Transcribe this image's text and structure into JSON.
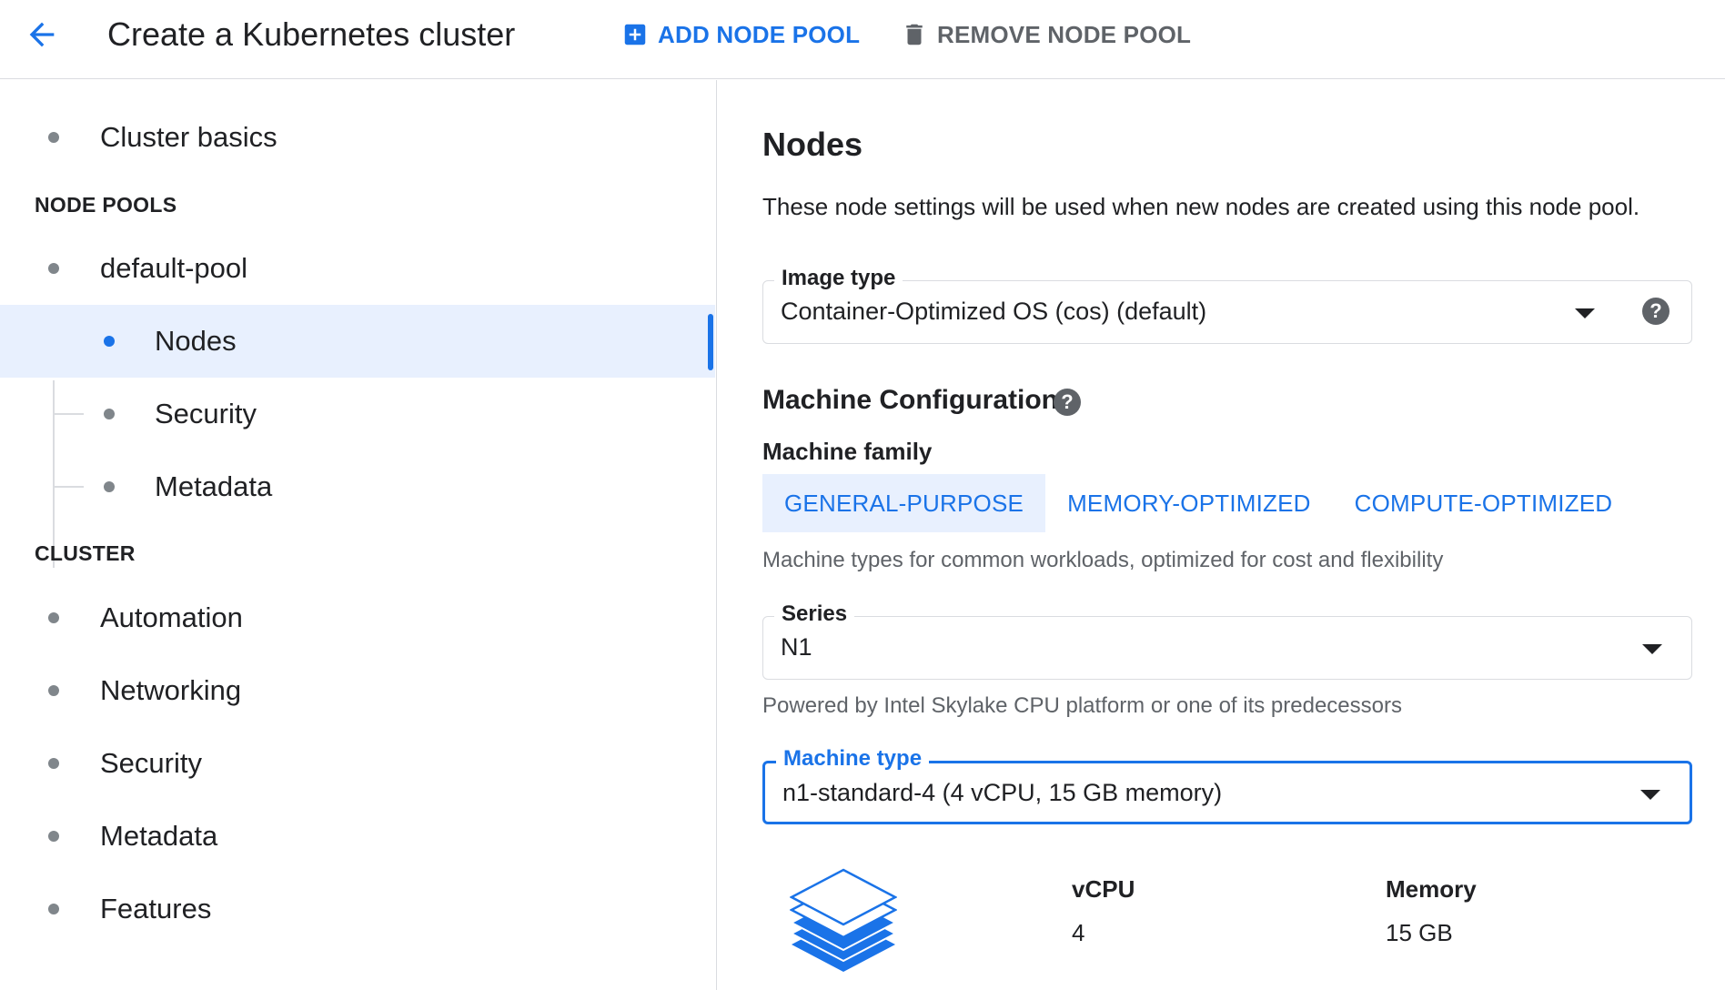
{
  "header": {
    "title": "Create a Kubernetes cluster",
    "add_node_pool": "ADD NODE POOL",
    "remove_node_pool": "REMOVE NODE POOL"
  },
  "sidebar": {
    "cluster_basics": "Cluster basics",
    "node_pools_header": "NODE POOLS",
    "default_pool": "default-pool",
    "pool_items": [
      "Nodes",
      "Security",
      "Metadata"
    ],
    "cluster_header": "CLUSTER",
    "cluster_items": [
      "Automation",
      "Networking",
      "Security",
      "Metadata",
      "Features"
    ]
  },
  "main": {
    "title": "Nodes",
    "description": "These node settings will be used when new nodes are created using this node pool.",
    "image_type": {
      "label": "Image type",
      "value": "Container-Optimized OS (cos) (default)"
    },
    "machine_config_title": "Machine Configuration",
    "machine_family_title": "Machine family",
    "family_tabs": [
      "GENERAL-PURPOSE",
      "MEMORY-OPTIMIZED",
      "COMPUTE-OPTIMIZED"
    ],
    "family_helper": "Machine types for common workloads, optimized for cost and flexibility",
    "series": {
      "label": "Series",
      "value": "N1"
    },
    "series_helper": "Powered by Intel Skylake CPU platform or one of its predecessors",
    "machine_type": {
      "label": "Machine type",
      "value": "n1-standard-4 (4 vCPU, 15 GB memory)"
    },
    "stats": {
      "vcpu_label": "vCPU",
      "vcpu_value": "4",
      "memory_label": "Memory",
      "memory_value": "15 GB"
    }
  },
  "colors": {
    "accent": "#1a73e8",
    "selected_bg": "#e8f0fe",
    "muted": "#5f6368"
  },
  "icons": [
    "arrow-back-icon",
    "add-box-icon",
    "trash-icon",
    "chevron-up-icon",
    "help-icon",
    "dropdown-caret-icon",
    "layers-icon"
  ]
}
